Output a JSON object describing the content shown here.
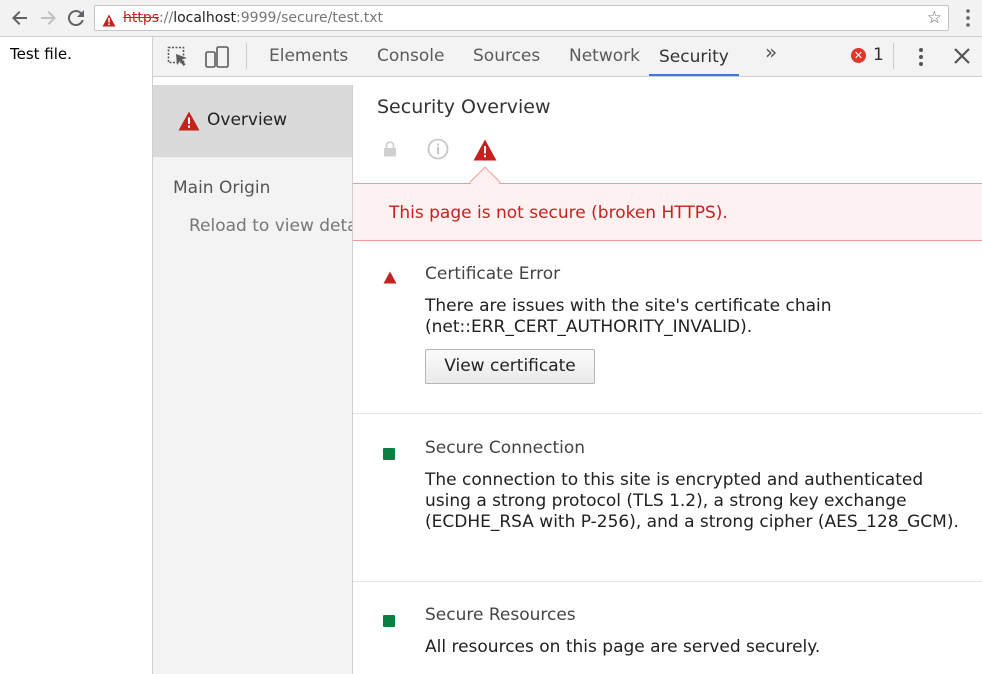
{
  "browser": {
    "url_scheme": "https",
    "url_sep": "://",
    "url_host": "localhost",
    "url_path": ":9999/secure/test.txt",
    "icons": [
      "back-arrow-icon",
      "forward-arrow-icon",
      "reload-icon",
      "not-secure-warning-icon",
      "bookmark-star-icon",
      "menu-kebab-icon"
    ]
  },
  "page": {
    "text": "Test file."
  },
  "devtools": {
    "tabs": [
      "Elements",
      "Console",
      "Sources",
      "Network",
      "Security"
    ],
    "active_tab": "Security",
    "more_tabs": "»",
    "error_count": "1",
    "close": "✕"
  },
  "security": {
    "sidebar": {
      "overview_label": "Overview",
      "main_origin_title": "Main Origin",
      "main_origin_reload": "Reload to view details"
    },
    "overview": {
      "title": "Security Overview",
      "summary": "This page is not secure (broken HTTPS)."
    },
    "sections": [
      {
        "title": "Certificate Error",
        "description": "There are issues with the site's certificate chain (net::ERR_CERT_AUTHORITY_INVALID).",
        "button": "View certificate",
        "status": "insecure"
      },
      {
        "title": "Secure Connection",
        "description": "The connection to this site is encrypted and authenticated using a strong protocol (TLS 1.2), a strong key exchange (ECDHE_RSA with P-256), and a strong cipher (AES_128_GCM).",
        "status": "secure"
      },
      {
        "title": "Secure Resources",
        "description": "All resources on this page are served securely.",
        "status": "secure"
      }
    ]
  },
  "colors": {
    "insecure": "#c5221f",
    "secure": "#0b8043",
    "active_tab_underline": "#3879d9"
  }
}
